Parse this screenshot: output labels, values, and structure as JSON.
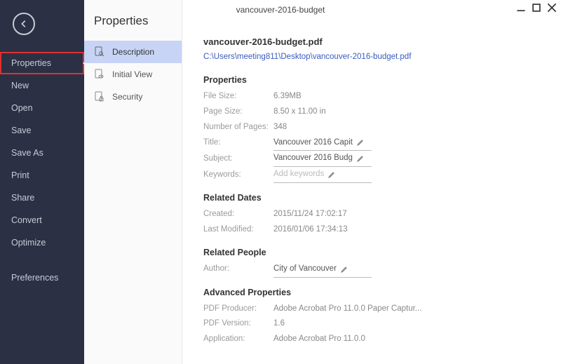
{
  "window": {
    "title": "vancouver-2016-budget"
  },
  "sidebar": {
    "items": [
      {
        "label": "Properties",
        "active": true
      },
      {
        "label": "New"
      },
      {
        "label": "Open"
      },
      {
        "label": "Save"
      },
      {
        "label": "Save As"
      },
      {
        "label": "Print"
      },
      {
        "label": "Share"
      },
      {
        "label": "Convert"
      },
      {
        "label": "Optimize"
      }
    ],
    "footer": {
      "label": "Preferences"
    }
  },
  "secondary": {
    "title": "Properties",
    "items": [
      {
        "label": "Description",
        "active": true
      },
      {
        "label": "Initial View"
      },
      {
        "label": "Security"
      }
    ]
  },
  "doc": {
    "filename": "vancouver-2016-budget.pdf",
    "path": "C:\\Users\\meeting811\\Desktop\\vancouver-2016-budget.pdf"
  },
  "sections": {
    "properties": {
      "title": "Properties",
      "file_size": {
        "label": "File Size:",
        "value": "6.39MB"
      },
      "page_size": {
        "label": "Page Size:",
        "value": "8.50 x 11.00 in"
      },
      "num_pages": {
        "label": "Number of Pages:",
        "value": "348"
      },
      "title_field": {
        "label": "Title:",
        "value": "Vancouver 2016 Capit"
      },
      "subject": {
        "label": "Subject:",
        "value": "Vancouver 2016 Budg"
      },
      "keywords": {
        "label": "Keywords:",
        "placeholder": "Add keywords"
      }
    },
    "dates": {
      "title": "Related Dates",
      "created": {
        "label": "Created:",
        "value": "2015/11/24 17:02:17"
      },
      "modified": {
        "label": "Last Modified:",
        "value": "2016/01/06 17:34:13"
      }
    },
    "people": {
      "title": "Related People",
      "author": {
        "label": "Author:",
        "value": "City of Vancouver"
      }
    },
    "advanced": {
      "title": "Advanced Properties",
      "producer": {
        "label": "PDF Producer:",
        "value": "Adobe Acrobat Pro 11.0.0 Paper Captur..."
      },
      "version": {
        "label": "PDF Version:",
        "value": "1.6"
      },
      "application": {
        "label": "Application:",
        "value": "Adobe Acrobat Pro 11.0.0"
      }
    }
  }
}
